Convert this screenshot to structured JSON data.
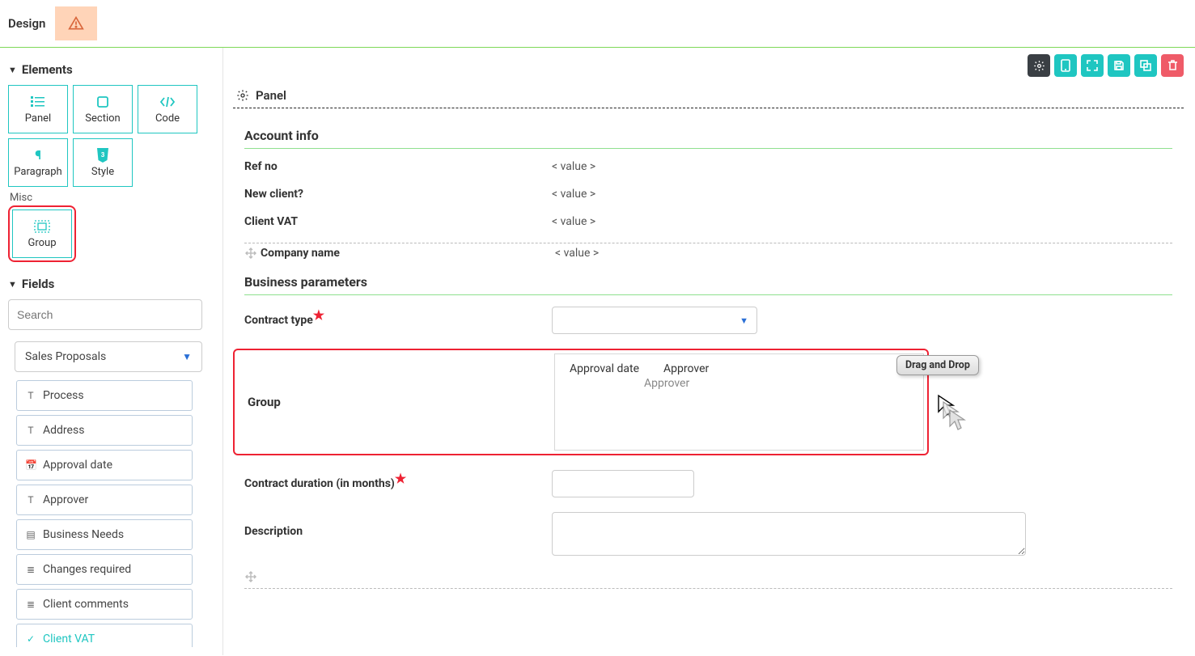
{
  "topbar": {
    "design": "Design"
  },
  "sidebar": {
    "elements_hdr": "Elements",
    "tiles": [
      {
        "label": "Panel"
      },
      {
        "label": "Section"
      },
      {
        "label": "Code"
      },
      {
        "label": "Paragraph"
      },
      {
        "label": "Style"
      }
    ],
    "misc_label": "Misc",
    "group_tile": "Group",
    "fields_hdr": "Fields",
    "search_placeholder": "Search",
    "dropdown_selected": "Sales Proposals",
    "field_items": [
      {
        "label": "Process",
        "ico": "T"
      },
      {
        "label": "Address",
        "ico": "T"
      },
      {
        "label": "Approval date",
        "ico": "📅"
      },
      {
        "label": "Approver",
        "ico": "T"
      },
      {
        "label": "Business Needs",
        "ico": "▤"
      },
      {
        "label": "Changes required",
        "ico": "≣"
      },
      {
        "label": "Client comments",
        "ico": "≣"
      },
      {
        "label": "Client VAT",
        "ico": "✓",
        "active": true
      }
    ]
  },
  "canvas": {
    "panel_label": "Panel",
    "account_hdr": "Account info",
    "account_rows": [
      {
        "label": "Ref no",
        "value": "< value >"
      },
      {
        "label": "New client?",
        "value": "< value >"
      },
      {
        "label": "Client VAT",
        "value": "< value >"
      },
      {
        "label": "Company name",
        "value": "< value >"
      }
    ],
    "business_hdr": "Business parameters",
    "contract_type_label": "Contract type",
    "group_label": "Group",
    "group_cols": {
      "c1": "Approval date",
      "c2": "Approver",
      "c3": "Approver"
    },
    "duration_label": "Contract duration (in months)",
    "description_label": "Description",
    "dnd_tip": "Drag and Drop"
  }
}
